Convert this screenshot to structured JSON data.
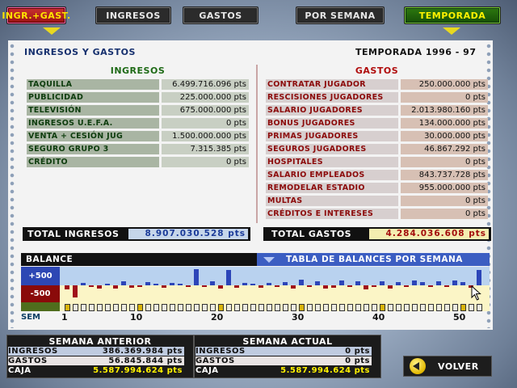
{
  "tabs": [
    {
      "label": "INGR.+GAST."
    },
    {
      "label": "INGRESOS"
    },
    {
      "label": "GASTOS"
    },
    {
      "label": "POR SEMANA"
    },
    {
      "label": "TEMPORADA"
    }
  ],
  "header": {
    "title": "INGRESOS Y GASTOS",
    "season": "TEMPORADA 1996 - 97"
  },
  "ingresos": {
    "heading": "INGRESOS",
    "rows": [
      {
        "label": "TAQUILLA",
        "value": "6.499.716.096 pts"
      },
      {
        "label": "PUBLICIDAD",
        "value": "225.000.000 pts"
      },
      {
        "label": "TELEVISIÓN",
        "value": "675.000.000 pts"
      },
      {
        "label": "INGRESOS U.E.F.A.",
        "value": "0 pts"
      },
      {
        "label": "VENTA + CESIÓN JUG",
        "value": "1.500.000.000 pts"
      },
      {
        "label": "SEGURO GRUPO 3",
        "value": "7.315.385 pts"
      },
      {
        "label": "CRÉDITO",
        "value": "0 pts"
      }
    ],
    "total_label": "TOTAL INGRESOS",
    "total_value": "8.907.030.528 pts"
  },
  "gastos": {
    "heading": "GASTOS",
    "rows": [
      {
        "label": "CONTRATAR JUGADOR",
        "value": "250.000.000 pts"
      },
      {
        "label": "RESCISIONES JUGADORES",
        "value": "0 pts"
      },
      {
        "label": "SALARIO JUGADORES",
        "value": "2.013.980.160 pts"
      },
      {
        "label": "BONUS JUGADORES",
        "value": "134.000.000 pts"
      },
      {
        "label": "PRIMAS JUGADORES",
        "value": "30.000.000 pts"
      },
      {
        "label": "SEGUROS JUGADORES",
        "value": "46.867.292 pts"
      },
      {
        "label": "HOSPITALES",
        "value": "0 pts"
      },
      {
        "label": "SALARIO EMPLEADOS",
        "value": "843.737.728 pts"
      },
      {
        "label": "REMODELAR ESTADIO",
        "value": "955.000.000 pts"
      },
      {
        "label": "MULTAS",
        "value": "0 pts"
      },
      {
        "label": "CRÉDITOS E INTERESES",
        "value": "0 pts"
      }
    ],
    "total_label": "TOTAL GASTOS",
    "total_value": "4.284.036.608 pts"
  },
  "balance": {
    "title": "BALANCE",
    "dropdown": "TABLA DE BALANCES POR SEMANA",
    "plus_label": "+500",
    "minus_label": "-500",
    "sem_label": "SEM",
    "tick_labels": [
      "1",
      "10",
      "20",
      "30",
      "40",
      "50"
    ]
  },
  "chart_data": {
    "type": "bar",
    "x": [
      1,
      2,
      3,
      4,
      5,
      6,
      7,
      8,
      9,
      10,
      11,
      12,
      13,
      14,
      15,
      16,
      17,
      18,
      19,
      20,
      21,
      22,
      23,
      24,
      25,
      26,
      27,
      28,
      29,
      30,
      31,
      32,
      33,
      34,
      35,
      36,
      37,
      38,
      39,
      40,
      41,
      42,
      43,
      44,
      45,
      46,
      47,
      48,
      49,
      50,
      51,
      52
    ],
    "values": [
      -120,
      -380,
      60,
      -60,
      -90,
      40,
      -100,
      120,
      -70,
      -50,
      90,
      40,
      -80,
      70,
      40,
      -60,
      450,
      -60,
      120,
      -90,
      430,
      -70,
      70,
      40,
      -80,
      60,
      -60,
      90,
      -100,
      150,
      -60,
      120,
      -110,
      -70,
      140,
      -60,
      110,
      -130,
      -60,
      120,
      -90,
      100,
      -60,
      130,
      80,
      -60,
      110,
      -60,
      140,
      80,
      -70,
      430
    ],
    "ylim": [
      -500,
      500
    ],
    "current_week": 44
  },
  "semana_anterior": {
    "title": "SEMANA ANTERIOR",
    "rows": [
      {
        "label": "INGRESOS",
        "value": "386.369.984 pts"
      },
      {
        "label": "GASTOS",
        "value": "56.845.844 pts"
      },
      {
        "label": "CAJA",
        "value": "5.587.994.624 pts"
      }
    ]
  },
  "semana_actual": {
    "title": "SEMANA ACTUAL",
    "rows": [
      {
        "label": "INGRESOS",
        "value": "0 pts"
      },
      {
        "label": "GASTOS",
        "value": "0 pts"
      },
      {
        "label": "CAJA",
        "value": "5.587.994.624 pts"
      }
    ]
  },
  "volver_label": "VOLVER",
  "colors": {
    "positive_bar": "#2c45b8",
    "negative_bar": "#a0101a",
    "total_income": "#1b3b99",
    "total_expense": "#a30c0c",
    "caja": "#fff200"
  }
}
